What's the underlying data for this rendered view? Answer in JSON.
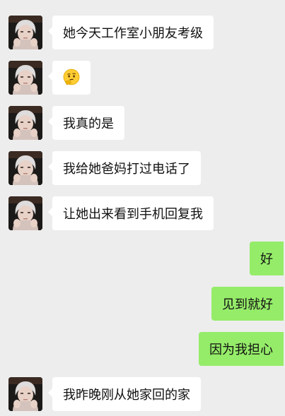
{
  "conversation": {
    "messages": [
      {
        "side": "in",
        "text": "她今天工作室小朋友考级"
      },
      {
        "side": "in",
        "text": "",
        "emoji": "thinking-face-emoji"
      },
      {
        "side": "in",
        "text": "我真的是"
      },
      {
        "side": "in",
        "text": "我给她爸妈打过电话了"
      },
      {
        "side": "in",
        "text": "让她出来看到手机回复我"
      },
      {
        "side": "out",
        "text": "好"
      },
      {
        "side": "out",
        "text": "见到就好"
      },
      {
        "side": "out",
        "text": "因为我担心"
      },
      {
        "side": "in",
        "text": "我昨晚刚从她家回的家"
      }
    ]
  },
  "colors": {
    "background": "#ededed",
    "incoming_bubble": "#ffffff",
    "outgoing_bubble": "#95ec69",
    "text": "#111111"
  }
}
